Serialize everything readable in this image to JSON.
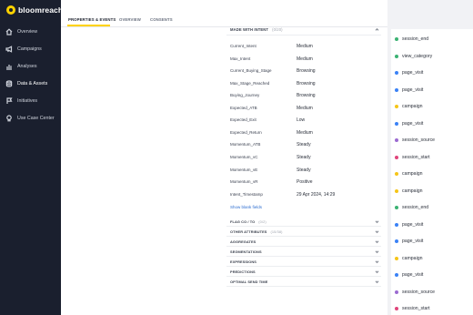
{
  "brand": {
    "name": "bloomreach"
  },
  "sidebar": {
    "items": [
      {
        "label": "Overview",
        "icon": "home-icon"
      },
      {
        "label": "Campaigns",
        "icon": "megaphone-icon"
      },
      {
        "label": "Analyses",
        "icon": "chart-icon"
      },
      {
        "label": "Data & Assets",
        "icon": "database-icon",
        "active": true
      },
      {
        "label": "Initiatives",
        "icon": "flag-icon"
      },
      {
        "label": "Use Case Center",
        "icon": "lightbulb-icon"
      }
    ]
  },
  "tabs": [
    {
      "label": "PROPERTIES & EVENTS",
      "active": true
    },
    {
      "label": "OVERVIEW"
    },
    {
      "label": "CONSENTS"
    }
  ],
  "panel": {
    "header": {
      "title": "MADE WITH INTENT",
      "count": "(0/20)"
    },
    "attributes": [
      {
        "name": "Current_Intent",
        "value": "Medium"
      },
      {
        "name": "Max_Intent",
        "value": "Medium"
      },
      {
        "name": "Current_Buying_Stage",
        "value": "Browsing"
      },
      {
        "name": "Max_Stage_Reached",
        "value": "Browsing"
      },
      {
        "name": "Buying_Journey",
        "value": "Browsing"
      },
      {
        "name": "Expected_ATB",
        "value": "Medium"
      },
      {
        "name": "Expected_Exit",
        "value": "Low"
      },
      {
        "name": "Expected_Return",
        "value": "Medium"
      },
      {
        "name": "Momentum_ATB",
        "value": "Steady"
      },
      {
        "name": "Momentum_vC",
        "value": "Steady"
      },
      {
        "name": "Momentum_vE",
        "value": "Steady"
      },
      {
        "name": "Momentum_vR",
        "value": "Positive"
      },
      {
        "name": "Intent_Timestamp",
        "value": "29 Apr 2024, 14:29"
      }
    ],
    "show_blank_label": "Show blank fields",
    "sections": [
      {
        "title": "FLAG CO / TO",
        "count": "(0/2)"
      },
      {
        "title": "OTHER ATTRIBUTES",
        "count": "(15/38)"
      },
      {
        "title": "AGGREGATES",
        "count": ""
      },
      {
        "title": "SEGMENTATIONS",
        "count": ""
      },
      {
        "title": "EXPRESSIONS",
        "count": ""
      },
      {
        "title": "PREDICTIONS",
        "count": ""
      },
      {
        "title": "OPTIMAL SEND TIME",
        "count": ""
      }
    ]
  },
  "events": [
    {
      "label": "session_end",
      "color": "#3bb273"
    },
    {
      "label": "view_category",
      "color": "#3bb273"
    },
    {
      "label": "page_visit",
      "color": "#3b82f6"
    },
    {
      "label": "page_visit",
      "color": "#3b82f6"
    },
    {
      "label": "campaign",
      "color": "#f5c518"
    },
    {
      "label": "page_visit",
      "color": "#3b82f6"
    },
    {
      "label": "session_source",
      "color": "#9b6bd1"
    },
    {
      "label": "session_start",
      "color": "#e0457b"
    },
    {
      "label": "campaign",
      "color": "#f5c518"
    },
    {
      "label": "campaign",
      "color": "#f5c518"
    },
    {
      "label": "session_end",
      "color": "#3bb273"
    },
    {
      "label": "page_visit",
      "color": "#3b82f6"
    },
    {
      "label": "page_visit",
      "color": "#3b82f6"
    },
    {
      "label": "campaign",
      "color": "#f5c518"
    },
    {
      "label": "page_visit",
      "color": "#3b82f6"
    },
    {
      "label": "session_source",
      "color": "#9b6bd1"
    },
    {
      "label": "session_start",
      "color": "#e0457b"
    }
  ]
}
